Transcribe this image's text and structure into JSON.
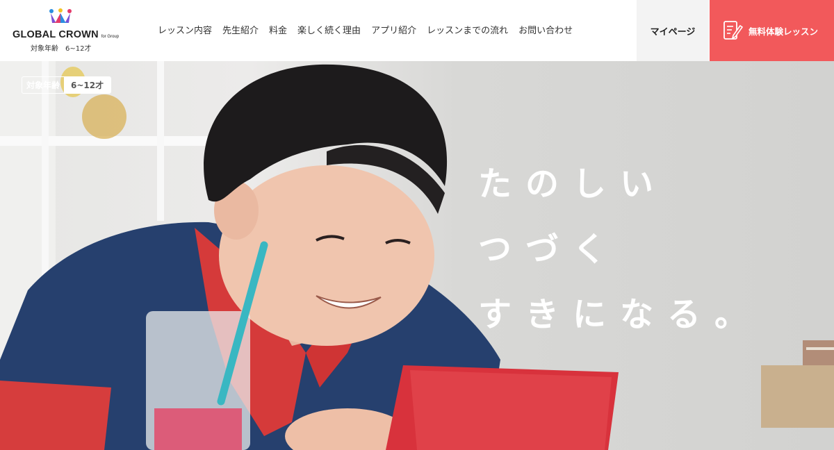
{
  "header": {
    "logo": {
      "brand": "GLOBAL CROWN",
      "brand_suffix": "for Group",
      "age": "対象年齢　6~12才"
    },
    "nav": [
      "レッスン内容",
      "先生紹介",
      "料金",
      "楽しく続く理由",
      "アプリ紹介",
      "レッスンまでの流れ",
      "お問い合わせ"
    ],
    "mypage_label": "マイページ",
    "trial_label": "無料体験レッスン",
    "colors": {
      "accent": "#f2595b",
      "mypage_bg": "#f3f3f3"
    }
  },
  "hero": {
    "age_badge": {
      "label": "対象年齢",
      "value": "6~12才"
    },
    "tagline": [
      "たのしい",
      "つづく",
      "すきになる。"
    ]
  }
}
